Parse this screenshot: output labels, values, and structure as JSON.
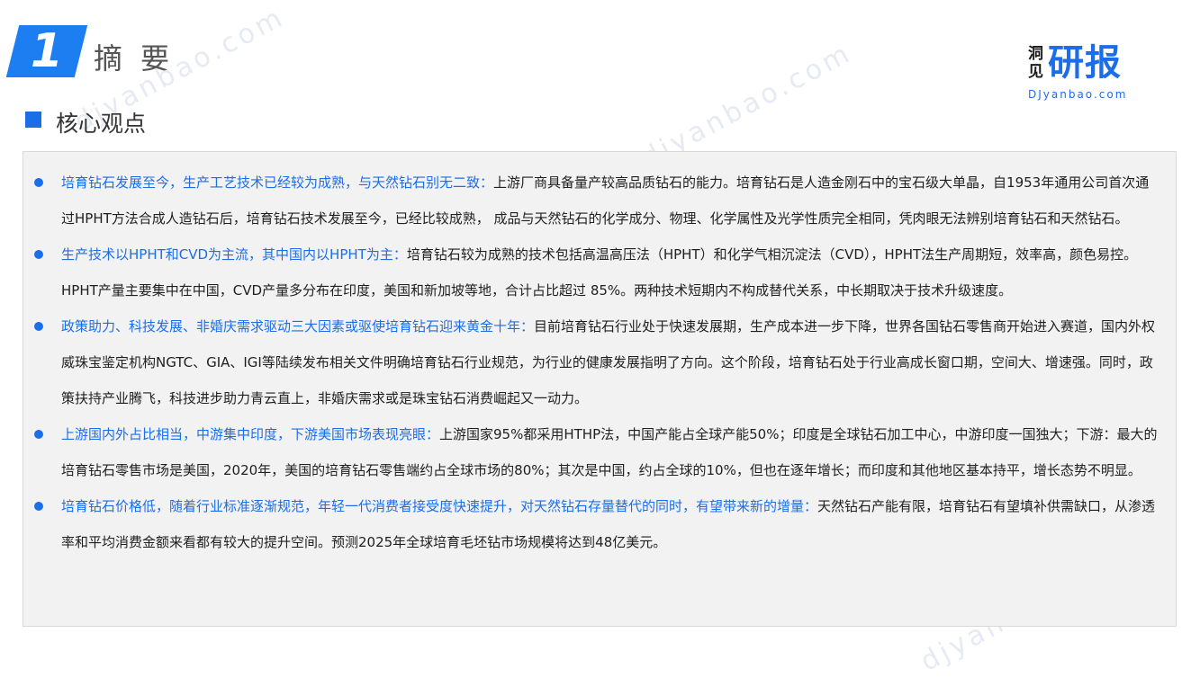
{
  "header": {
    "number": "1",
    "title": "摘要"
  },
  "logo": {
    "small": "洞见",
    "big": "研报",
    "url": "DJyanbao.com"
  },
  "watermark": "djyanbao.com",
  "section": {
    "title": "核心观点"
  },
  "points": [
    {
      "lead": "培育钻石发展至今，生产工艺技术已经较为成熟，与天然钻石别无二致：",
      "body": "上游厂商具备量产较高品质钻石的能力。培育钻石是人造金刚石中的宝石级大单晶，自1953年通用公司首次通过HPHT方法合成人造钻石后，培育钻石技术发展至今，已经比较成熟， 成品与天然钻石的化学成分、物理、化学属性及光学性质完全相同，凭肉眼无法辨别培育钻石和天然钻石。"
    },
    {
      "lead": "生产技术以HPHT和CVD为主流，其中国内以HPHT为主：",
      "body": "培育钻石较为成熟的技术包括高温高压法（HPHT）和化学气相沉淀法（CVD），HPHT法生产周期短，效率高，颜色易控。HPHT产量主要集中在中国，CVD产量多分布在印度，美国和新加坡等地，合计占比超过 85%。两种技术短期内不构成替代关系，中长期取决于技术升级速度。"
    },
    {
      "lead": "政策助力、科技发展、非婚庆需求驱动三大因素或驱使培育钻石迎来黄金十年：",
      "body": "目前培育钻石行业处于快速发展期，生产成本进一步下降，世界各国钻石零售商开始进入赛道，国内外权威珠宝鉴定机构NGTC、GIA、IGI等陆续发布相关文件明确培育钻石行业规范，为行业的健康发展指明了方向。这个阶段，培育钻石处于行业高成长窗口期，空间大、增速强。同时，政策扶持产业腾飞，科技进步助力青云直上，非婚庆需求或是珠宝钻石消费崛起又一动力。"
    },
    {
      "lead": "上游国内外占比相当，中游集中印度，下游美国市场表现亮眼：",
      "body": "上游国家95%都采用HTHP法，中国产能占全球产能50%；印度是全球钻石加工中心，中游印度一国独大；下游：最大的培育钻石零售市场是美国，2020年，美国的培育钻石零售端约占全球市场的80%；其次是中国，约占全球的10%，但也在逐年增长；而印度和其他地区基本持平，增长态势不明显。"
    },
    {
      "lead": "培育钻石价格低，随着行业标准逐渐规范，年轻一代消费者接受度快速提升，对天然钻石存量替代的同时，有望带来新的增量：",
      "body": "天然钻石产能有限，培育钻石有望填补供需缺口，从渗透率和平均消费金额来看都有较大的提升空间。预测2025年全球培育毛坯钻市场规模将达到48亿美元。"
    }
  ],
  "colors": {
    "accent": "#1c6ee8",
    "panel_bg": "#f2f2f2",
    "text": "#1f1f1f"
  }
}
